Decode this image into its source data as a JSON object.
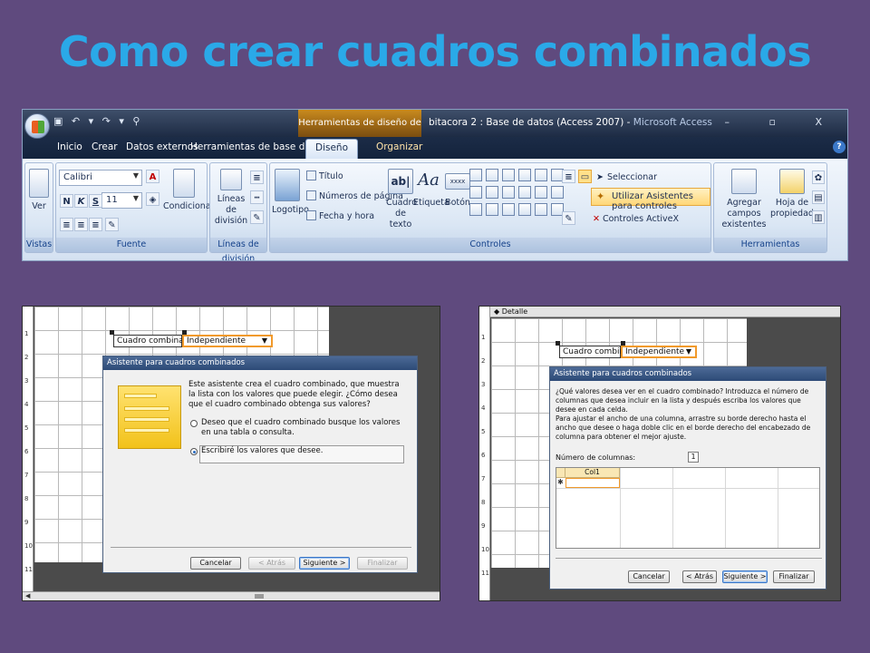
{
  "slide": {
    "title": "Como crear cuadros combinados"
  },
  "ribbon": {
    "contextual_tools": "Herramientas de diseño de formulario",
    "window_title": "bitacora 2 : Base de datos (Access 2007) - ",
    "app_name": "Microsoft Access",
    "qat_icons": "▣ ↶ ▾ ↷ ▾ ⚲",
    "window_buttons": "– ▫ X",
    "help": "?",
    "tabs": [
      "Inicio",
      "Crear",
      "Datos externos",
      "Herramientas de base de datos",
      "Diseño",
      "Organizar"
    ],
    "groups": {
      "vistas": {
        "label": "Vistas",
        "ver": "Ver"
      },
      "fuente": {
        "label": "Fuente",
        "font": "Calibri",
        "size": "11",
        "bold": "N",
        "italic": "K",
        "underline": "S",
        "color_letter": "A",
        "condicional": "Condicional"
      },
      "division": {
        "label": "Líneas de división",
        "button": "Líneas de división"
      },
      "controles": {
        "label": "Controles",
        "logotipo": "Logotipo",
        "titulo": "Título",
        "numeros": "Números de página",
        "fecha": "Fecha y hora",
        "cuadro_texto": "Cuadro de texto",
        "cuadro_texto_glyph": "ab|",
        "etiqueta": "Etiqueta",
        "etiqueta_glyph": "Aa",
        "boton": "Botón",
        "boton_glyph": "xxxx",
        "seleccionar": "Seleccionar",
        "asistentes": "Utilizar Asistentes para controles",
        "activex": "Controles ActiveX"
      },
      "herramientas": {
        "label": "Herramientas",
        "agregar": "Agregar campos existentes",
        "hoja": "Hoja de propiedades"
      }
    }
  },
  "left_panel": {
    "ruler": [
      "1",
      "2",
      "3",
      "4",
      "5",
      "6",
      "7",
      "8",
      "9",
      "10",
      "11"
    ],
    "label": "Cuadro combinad",
    "combo": "Independiente",
    "dialog": {
      "title": "Asistente para cuadros combinados",
      "intro": "Este asistente crea el cuadro combinado, que muestra la lista con los valores que puede elegir. ¿Cómo desea que el cuadro combinado obtenga sus valores?",
      "option1": "Deseo que el cuadro combinado busque los valores en una tabla o consulta.",
      "option2": "Escribiré los valores que desee.",
      "buttons": {
        "cancel": "Cancelar",
        "back": "< Atrás",
        "next": "Siguiente >",
        "finish": "Finalizar"
      }
    }
  },
  "right_panel": {
    "detail": "Detalle",
    "ruler": [
      "1",
      "2",
      "3",
      "4",
      "5",
      "6",
      "7",
      "8",
      "9",
      "10",
      "11"
    ],
    "label": "Cuadro combinad",
    "combo": "Independiente",
    "dialog": {
      "title": "Asistente para cuadros combinados",
      "intro": "¿Qué valores desea ver en el cuadro combinado? Introduzca el número de columnas que desea incluir en la lista y después escriba los valores que desee en cada celda.",
      "instructions": "Para ajustar el ancho de una columna, arrastre su borde derecho hasta el ancho que desee o haga doble clic en el borde derecho del encabezado de columna para obtener el mejor ajuste.",
      "columns_label": "Número de columnas:",
      "columns_value": "1",
      "col_header": "Col1",
      "new_row": "✱",
      "buttons": {
        "cancel": "Cancelar",
        "back": "< Atrás",
        "next": "Siguiente >",
        "finish": "Finalizar"
      }
    }
  },
  "colors": {
    "background": "#5f4a7e",
    "title": "#2aa9e8",
    "accent": "#f19a2c"
  }
}
